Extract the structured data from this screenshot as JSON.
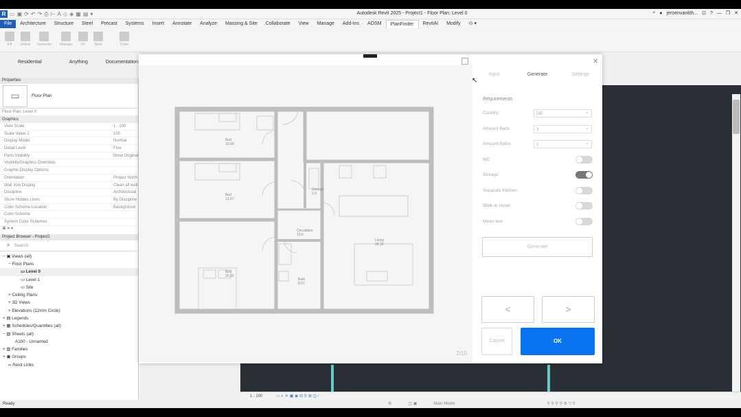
{
  "titlebar": {
    "title": "Autodesk Revit 2025 - Project1 - Floor Plan: Level 0",
    "user": "jeroenvanlith...",
    "help": "?"
  },
  "menu": [
    "File",
    "Architecture",
    "Structure",
    "Steel",
    "Precast",
    "Systems",
    "Insert",
    "Annotate",
    "Analyze",
    "Massing & Site",
    "Collaborate",
    "View",
    "Manage",
    "Add-Ins",
    "AOSM",
    "PlanFinder",
    "RevitAI",
    "Modify"
  ],
  "ribbon": [
    "Fill",
    "Unlock",
    "Generate",
    "Manage",
    "FF",
    "Back",
    "Draw"
  ],
  "ctx_tabs": [
    "Residential",
    "Anything",
    "Documentation"
  ],
  "properties": {
    "header": "Properties",
    "type_name": "Floor Plan",
    "instance": "Floor Plan: Level 0",
    "group": "Graphics",
    "rows": [
      {
        "k": "View Scale",
        "v": "1 : 100"
      },
      {
        "k": "Scale Value    1:",
        "v": "100"
      },
      {
        "k": "Display Model",
        "v": "Normal"
      },
      {
        "k": "Detail Level",
        "v": "Fine"
      },
      {
        "k": "Parts Visibility",
        "v": "Show Original"
      },
      {
        "k": "Visibility/Graphics Overrides",
        "v": ""
      },
      {
        "k": "Graphic Display Options",
        "v": ""
      },
      {
        "k": "Orientation",
        "v": "Project North"
      },
      {
        "k": "Wall Join Display",
        "v": "Clean all wall"
      },
      {
        "k": "Discipline",
        "v": "Architectural"
      },
      {
        "k": "Show Hidden Lines",
        "v": "By Discipline"
      },
      {
        "k": "Color Scheme Location",
        "v": "Background"
      },
      {
        "k": "Color Scheme",
        "v": ""
      },
      {
        "k": "System Color Schemes",
        "v": ""
      }
    ]
  },
  "browser": {
    "header": "Project Browser - Project1",
    "search": "Search",
    "items": [
      "Views (all)",
      "Floor Plans",
      "Level 0",
      "Level 1",
      "Site",
      "Ceiling Plans",
      "3D Views",
      "Elevations (12mm Circle)",
      "Legends",
      "Schedules/Quantities (all)",
      "Sheets (all)",
      "A100 - Unnamed",
      "Families",
      "Groups",
      "Revit Links"
    ]
  },
  "dialog": {
    "tabs": [
      "Input",
      "Generate",
      "Settings"
    ],
    "active_tab": "Generate",
    "requirements_title": "Requirements",
    "fields": [
      {
        "label": "Country",
        "value": "DE"
      },
      {
        "label": "Amount Beds",
        "value": "3"
      },
      {
        "label": "Amount Baths",
        "value": "1"
      }
    ],
    "toggles": [
      {
        "label": "WC",
        "on": false
      },
      {
        "label": "Storage",
        "on": true
      },
      {
        "label": "Separate Kitchen",
        "on": false
      },
      {
        "label": "Walk-in closet",
        "on": false
      },
      {
        "label": "Meter box",
        "on": false
      }
    ],
    "generate_label": "Generate",
    "prev": "<",
    "next": ">",
    "cancel": "Cancel",
    "ok": "OK",
    "page": "2/10",
    "close": "×",
    "rooms": [
      {
        "name": "Bed",
        "area": "10.90"
      },
      {
        "name": "Bed",
        "area": "13.57"
      },
      {
        "name": "Bed",
        "area": "20.20"
      },
      {
        "name": "Storage",
        "area": "2.9"
      },
      {
        "name": "Circulation",
        "area": "10.6"
      },
      {
        "name": "Bath",
        "area": "8.07"
      },
      {
        "name": "Living",
        "area": "38.10"
      }
    ]
  },
  "view_status": {
    "scale": "1 : 100"
  },
  "status": {
    "left": "Ready",
    "model": "Main Model"
  }
}
